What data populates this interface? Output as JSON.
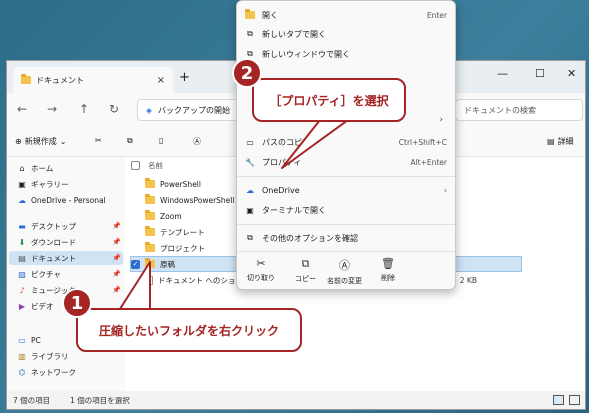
{
  "window": {
    "tab_title": "ドキュメント",
    "tab_close": "×",
    "new_tab": "+",
    "controls": {
      "minimize": "—",
      "maximize": "☐",
      "close": "✕"
    }
  },
  "address": {
    "back": "←",
    "forward": "→",
    "up": "↑",
    "refresh": "↻",
    "breadcrumb": "バックアップの開始",
    "search_placeholder": "ドキュメントの検索"
  },
  "toolbar": {
    "new_label": "新規作成",
    "new_icon": "⊕",
    "cut": "✂",
    "copy": "⧉",
    "paste": "▯",
    "rename": "Ⓐ",
    "share": "⇪",
    "delete": "🗑",
    "details": "詳細"
  },
  "nav": {
    "items": [
      {
        "label": "ホーム",
        "icon": "⌂"
      },
      {
        "label": "ギャラリー",
        "icon": "▣"
      },
      {
        "label": "OneDrive - Personal",
        "icon": "☁"
      },
      {
        "label": "デスクトップ",
        "icon": "▬"
      },
      {
        "label": "ダウンロード",
        "icon": "⬇"
      },
      {
        "label": "ドキュメント",
        "icon": "▤"
      },
      {
        "label": "ピクチャ",
        "icon": "▨"
      },
      {
        "label": "ミュージック",
        "icon": "♪"
      },
      {
        "label": "ビデオ",
        "icon": "▶"
      },
      {
        "label": "PC",
        "icon": "▭"
      },
      {
        "label": "ライブラリ",
        "icon": "▥"
      },
      {
        "label": "ネットワーク",
        "icon": "⌬"
      }
    ],
    "pin": "📌"
  },
  "files": {
    "col_name": "名前",
    "rows": [
      {
        "name": "PowerShell"
      },
      {
        "name": "WindowsPowerShell"
      },
      {
        "name": "Zoom"
      },
      {
        "name": "テンプレート"
      },
      {
        "name": "プロジェクト"
      },
      {
        "name": "原稿",
        "selected": true
      },
      {
        "name": "ドキュメント へのショートカ",
        "size": "2 KB"
      }
    ]
  },
  "status": {
    "count": "7 個の項目",
    "selected": "1 個の項目を選択"
  },
  "menu": {
    "items": [
      {
        "label": "開く",
        "shortcut": "Enter",
        "icon": "▰"
      },
      {
        "label": "新しいタブで開く",
        "shortcut": "",
        "icon": "⧉"
      },
      {
        "label": "新しいウィンドウで開く",
        "shortcut": "",
        "icon": "⧉"
      },
      {
        "label": "パスのコピー",
        "shortcut": "Ctrl+Shift+C",
        "icon": "▭"
      },
      {
        "label": "プロパティ",
        "shortcut": "Alt+Enter",
        "icon": "🔧"
      },
      {
        "label": "OneDrive",
        "shortcut": "›",
        "icon": "☁"
      },
      {
        "label": "ターミナルで開く",
        "shortcut": "",
        "icon": "▣"
      },
      {
        "label": "その他のオプションを確認",
        "shortcut": "",
        "icon": "⧉"
      }
    ],
    "submenu_arrow": "›",
    "bottom": [
      {
        "label": "切り取り",
        "icon": "✂"
      },
      {
        "label": "コピー",
        "icon": "⧉"
      },
      {
        "label": "名前の変更",
        "icon": "Ⓐ"
      },
      {
        "label": "削除",
        "icon": "🗑"
      }
    ]
  },
  "callouts": {
    "step1_number": "1",
    "step1_text": "圧縮したいフォルダを右クリック",
    "step2_number": "2",
    "step2_text": "［プロパティ］を選択"
  },
  "colors": {
    "accent": "#a52424",
    "selection": "#cfe3f5",
    "folder": "#f4c34c"
  }
}
